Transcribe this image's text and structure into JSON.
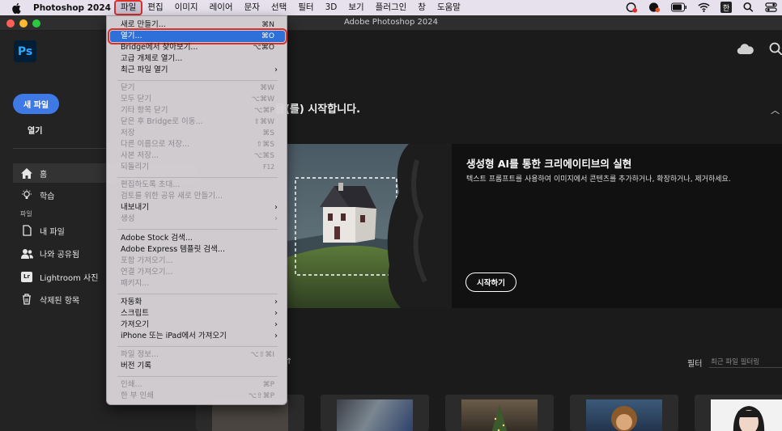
{
  "menubar": {
    "app_name": "Photoshop 2024",
    "menus": [
      "파일",
      "편집",
      "이미지",
      "레이어",
      "문자",
      "선택",
      "필터",
      "3D",
      "보기",
      "플러그인",
      "창",
      "도움말"
    ],
    "open_menu": "파일",
    "status_icons": [
      "creative-cloud-icon",
      "notification-icon",
      "battery-icon",
      "wifi-icon",
      "input-method-icon",
      "search-icon",
      "control-center-icon"
    ],
    "input_method": "한"
  },
  "window": {
    "title": "Adobe Photoshop 2024"
  },
  "sidebar": {
    "logo": "Ps",
    "new_file": "새 파일",
    "open": "열기",
    "nav": [
      {
        "label": "홈",
        "icon": "home-icon"
      },
      {
        "label": "학습",
        "icon": "learn-bulb-icon"
      }
    ],
    "section_label": "파일",
    "files_nav": [
      {
        "label": "내 파일",
        "icon": "file-icon"
      },
      {
        "label": "나와 공유됨",
        "icon": "shared-users-icon"
      },
      {
        "label": "Lightroom 사진",
        "icon": "lightroom-icon"
      },
      {
        "label": "삭제된 항목",
        "icon": "trash-icon"
      }
    ]
  },
  "main": {
    "welcome_suffix": "을(를) 시작합니다.",
    "banner": {
      "title": "생성형 AI를 통한 크리에이티브의 실현",
      "description": "텍스트 프롬프트를 사용하여 이미지에서 콘텐츠를 추가하거나, 확장하거나, 제거하세요.",
      "button": "시작하기"
    },
    "filter_label": "필터",
    "filter_placeholder": "최근 파일 필터링"
  },
  "file_menu": [
    {
      "label": "새로 만들기...",
      "shortcut": "⌘N",
      "state": "normal"
    },
    {
      "label": "열기...",
      "shortcut": "⌘O",
      "state": "highlighted"
    },
    {
      "label": "Bridge에서 찾아보기...",
      "shortcut": "⌥⌘O",
      "state": "normal"
    },
    {
      "label": "고급 개체로 열기...",
      "shortcut": "",
      "state": "normal"
    },
    {
      "label": "최근 파일 열기",
      "shortcut": "",
      "state": "submenu"
    },
    {
      "label": "닫기",
      "shortcut": "⌘W",
      "state": "disabled"
    },
    {
      "label": "모두 닫기",
      "shortcut": "⌥⌘W",
      "state": "disabled"
    },
    {
      "label": "기타 항목 닫기",
      "shortcut": "⌥⌘P",
      "state": "disabled"
    },
    {
      "label": "닫은 후 Bridge로 이동...",
      "shortcut": "⇧⌘W",
      "state": "disabled"
    },
    {
      "label": "저장",
      "shortcut": "⌘S",
      "state": "disabled"
    },
    {
      "label": "다른 이름으로 저장...",
      "shortcut": "⇧⌘S",
      "state": "disabled"
    },
    {
      "label": "사본 저장...",
      "shortcut": "⌥⌘S",
      "state": "disabled"
    },
    {
      "label": "되돌리기",
      "shortcut": "F12",
      "state": "disabled"
    },
    {
      "label": "편집하도록 초대...",
      "shortcut": "",
      "state": "disabled"
    },
    {
      "label": "검토를 위한 공유 새로 만들기...",
      "shortcut": "",
      "state": "disabled"
    },
    {
      "label": "내보내기",
      "shortcut": "",
      "state": "submenu"
    },
    {
      "label": "생성",
      "shortcut": "",
      "state": "disabled-submenu"
    },
    {
      "label": "Adobe Stock 검색...",
      "shortcut": "",
      "state": "normal"
    },
    {
      "label": "Adobe Express 템플릿 검색...",
      "shortcut": "",
      "state": "normal"
    },
    {
      "label": "포함 가져오기...",
      "shortcut": "",
      "state": "disabled"
    },
    {
      "label": "연결 가져오기...",
      "shortcut": "",
      "state": "disabled"
    },
    {
      "label": "패키지...",
      "shortcut": "",
      "state": "disabled"
    },
    {
      "label": "자동화",
      "shortcut": "",
      "state": "submenu"
    },
    {
      "label": "스크립트",
      "shortcut": "",
      "state": "submenu"
    },
    {
      "label": "가져오기",
      "shortcut": "",
      "state": "submenu"
    },
    {
      "label": "iPhone 또는 iPad에서 가져오기",
      "shortcut": "",
      "state": "submenu"
    },
    {
      "label": "파일 정보...",
      "shortcut": "⌥⇧⌘I",
      "state": "disabled"
    },
    {
      "label": "버전 기록",
      "shortcut": "",
      "state": "normal"
    },
    {
      "label": "인쇄...",
      "shortcut": "⌘P",
      "state": "disabled"
    },
    {
      "label": "한 부 인쇄",
      "shortcut": "⌥⇧⌘P",
      "state": "disabled"
    }
  ]
}
